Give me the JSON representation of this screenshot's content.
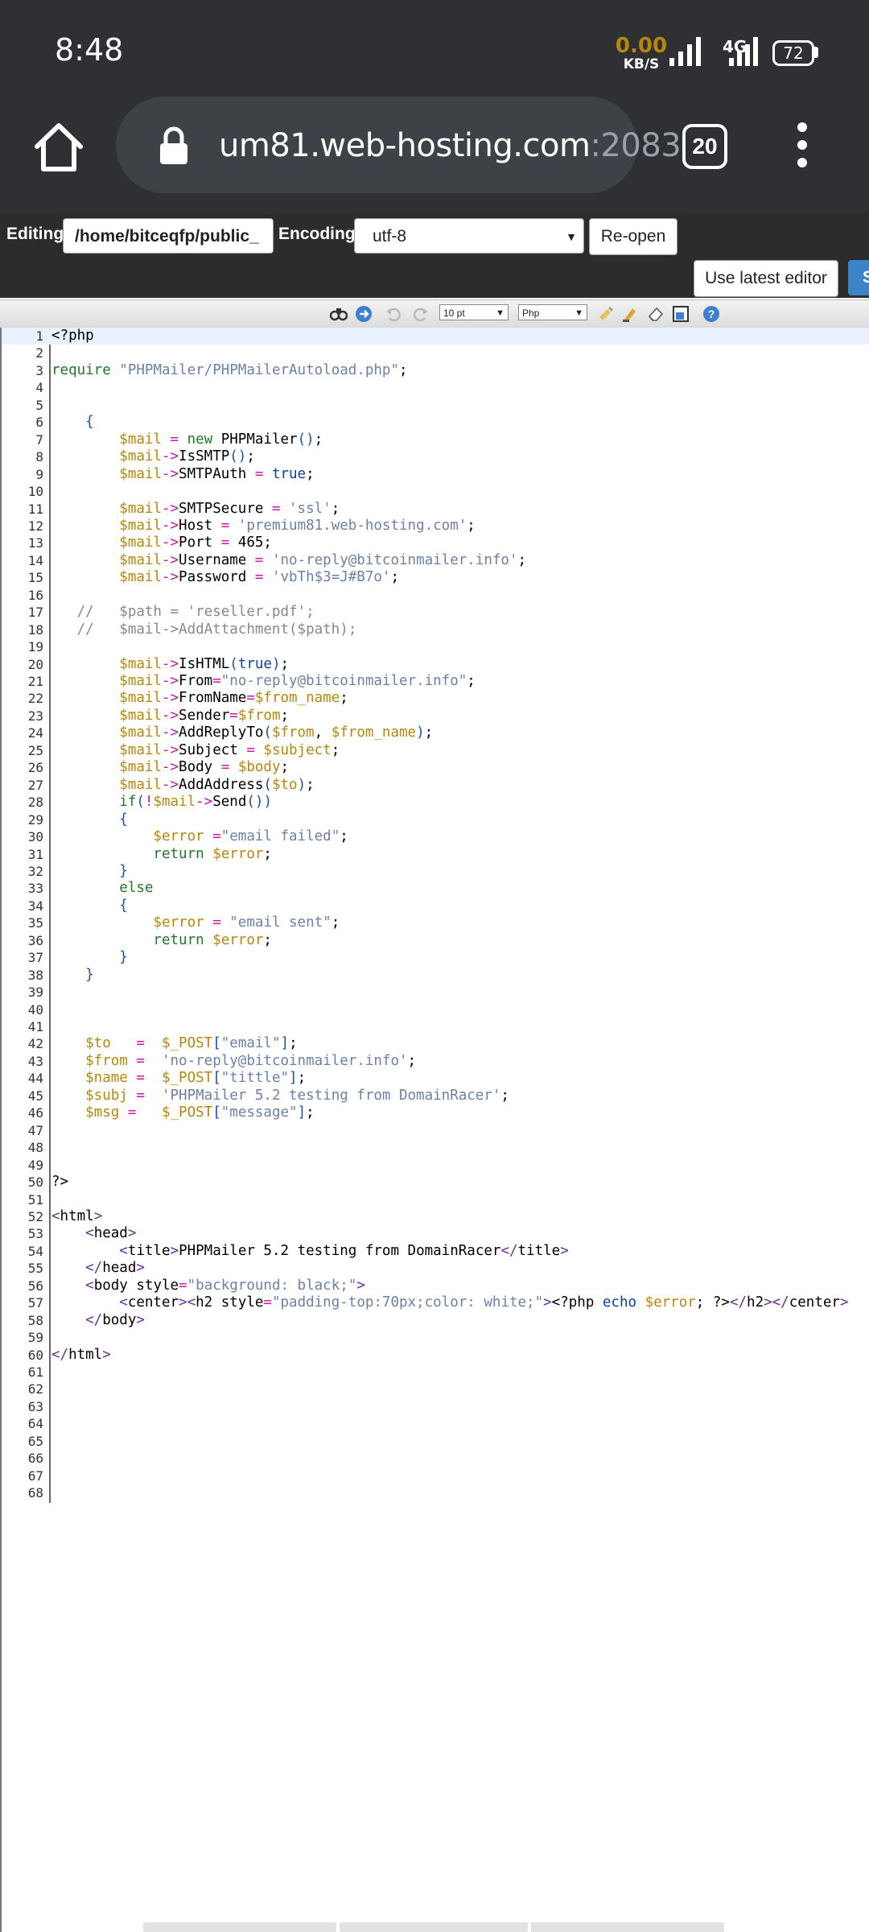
{
  "status_bar": {
    "time": "8:48",
    "net_speed_value": "0.00",
    "net_speed_unit": "KB/S",
    "network_type": "4G",
    "battery": "72"
  },
  "browser": {
    "url_host": "um81.web-hosting.com",
    "url_port": ":2083",
    "tab_count": "20",
    "icons": [
      "home-icon",
      "lock-icon",
      "menu-icon"
    ]
  },
  "editor_toolbar": {
    "editing_label": "Editing:",
    "path": "/home/bitceqfp/public_",
    "encoding_label": "Encoding:",
    "encoding_value": "utf-8",
    "reopen_label": "Re-open",
    "latest_editor_label": "Use latest editor",
    "save_label": "S"
  },
  "code_toolbar": {
    "font_size": "10 pt",
    "syntax": "Php"
  },
  "code": {
    "total_lines": 68,
    "active_line": 1
  }
}
